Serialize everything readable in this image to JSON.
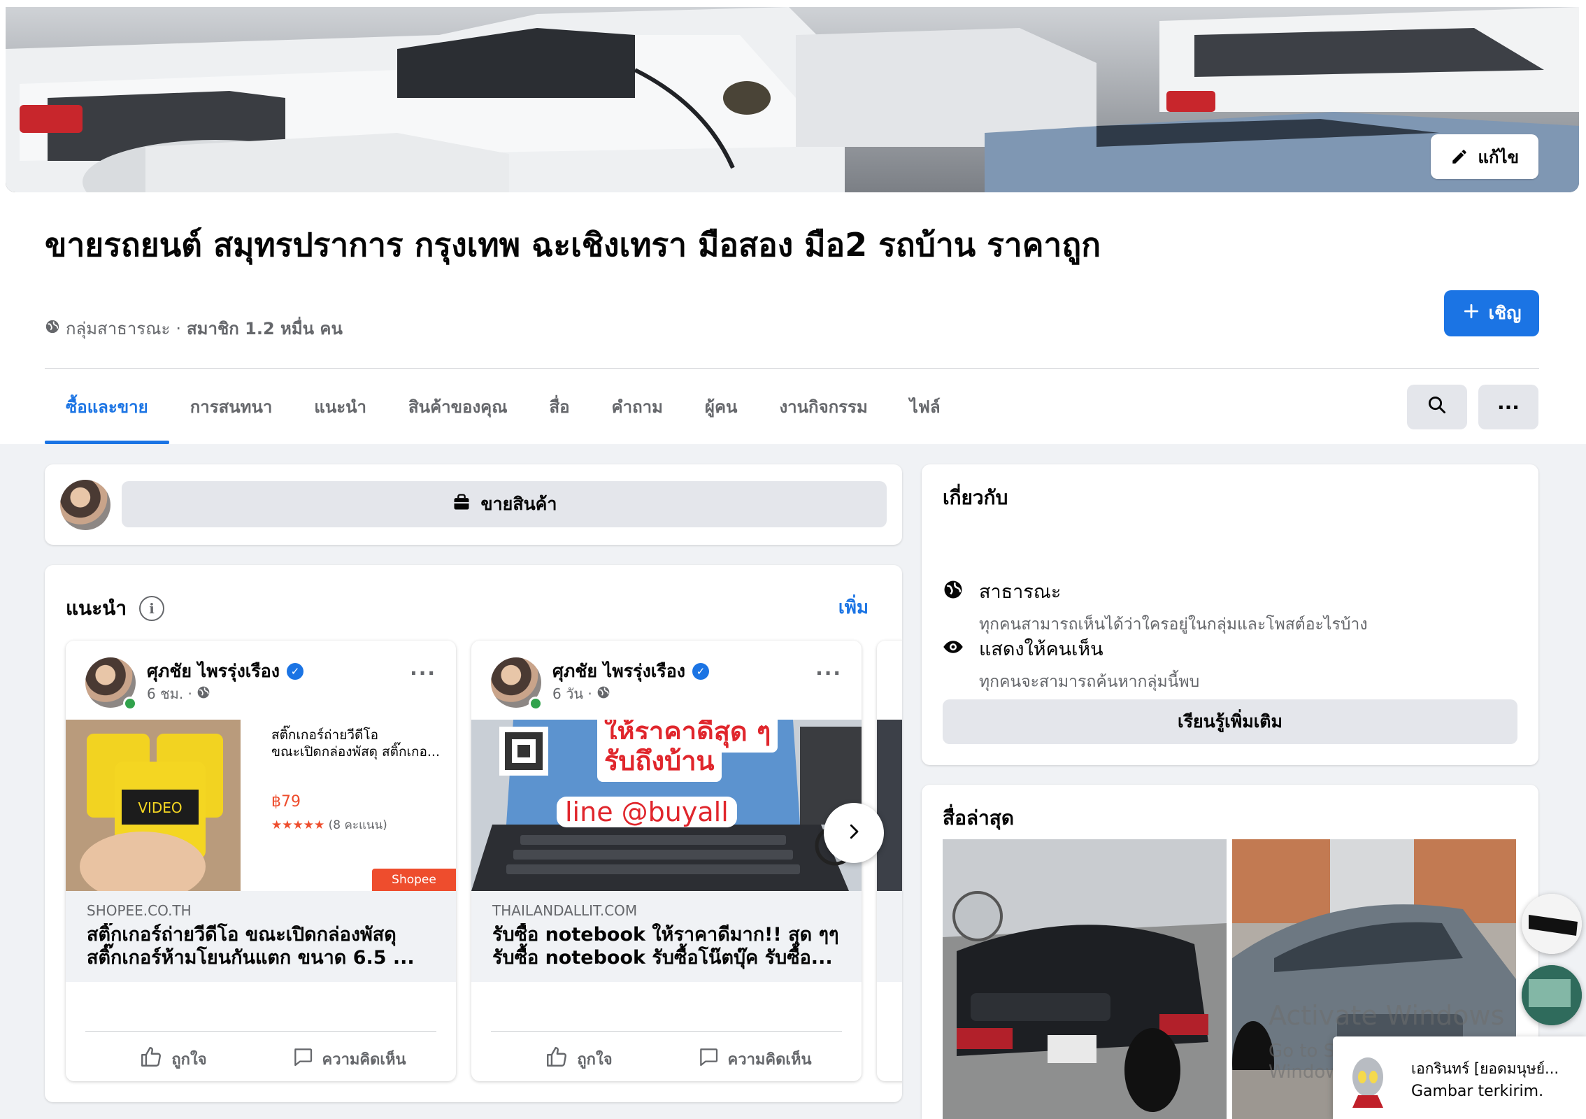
{
  "cover": {
    "edit_label": "แก้ไข"
  },
  "group": {
    "title": "ขายรถยนต์ สมุทรปราการ กรุงเทพ ฉะเชิงเทรา มือสอง มือ2 รถบ้าน ราคาถูก",
    "privacy": "กลุ่มสาธารณะ",
    "separator": "·",
    "members": "สมาชิก 1.2 หมื่น คน",
    "invite_label": "เชิญ"
  },
  "tabs": [
    {
      "label": "ซื้อและขาย",
      "active": true
    },
    {
      "label": "การสนทนา"
    },
    {
      "label": "แนะนำ"
    },
    {
      "label": "สินค้าของคุณ"
    },
    {
      "label": "สื่อ"
    },
    {
      "label": "คำถาม"
    },
    {
      "label": "ผู้คน"
    },
    {
      "label": "งานกิจกรรม"
    },
    {
      "label": "ไฟล์"
    }
  ],
  "tab_actions": {
    "more": "···"
  },
  "sell": {
    "label": "ขายสินค้า"
  },
  "recommended": {
    "title": "แนะนำ",
    "more_label": "เพิ่ม",
    "posts": [
      {
        "author": "ศุภชัย ไพรรุ่งเรือง",
        "time": "6 ชม. ·",
        "domain": "SHOPEE.CO.TH",
        "link_title": "สติ๊กเกอร์ถ่ายวีดีโอ ขณะเปิดกล่องพัสดุ สติ๊กเกอร์ห้ามโยนกันแตก ขนาด 6.5 ...",
        "promo_text_1": "สติ๊กเกอร์ถ่ายวีดีโอ",
        "promo_text_2": "ขณะเปิดกล่องพัสดุ สติ๊กเกอ...",
        "promo_price": "฿79",
        "promo_stars": "★★★★★",
        "promo_reviews": "(8 คะแนน)",
        "shopee_label": "Shopee",
        "like_label": "ถูกใจ",
        "comment_label": "ความคิดเห็น"
      },
      {
        "author": "ศุภชัย ไพรรุ่งเรือง",
        "time": "6 วัน ·",
        "domain": "THAILANDALLIT.COM",
        "link_title": "รับซื้อ notebook ให้ราคาดีมาก!! สุด ๆๆ รับซื้อ notebook รับซื้อโน๊ตบุ๊ค รับซื้อ...",
        "img_text_1": "ให้ราคาดีสุด ๆ",
        "img_text_2": "รับถึงบ้าน",
        "img_text_3": "line @buyall",
        "like_label": "ถูกใจ",
        "comment_label": "ความคิดเห็น"
      }
    ]
  },
  "about": {
    "title": "เกี่ยวกับ",
    "public_title": "สาธารณะ",
    "public_desc": "ทุกคนสามารถเห็นได้ว่าใครอยู่ในกลุ่มและโพสต์อะไรบ้าง",
    "visible_title": "แสดงให้คนเห็น",
    "visible_desc": "ทุกคนจะสามารถค้นหากลุ่มนี้พบ",
    "learn_more": "เรียนรู้เพิ่มเติม"
  },
  "media": {
    "title": "สื่อล่าสุด"
  },
  "windows": {
    "activate_title": "Activate Windows",
    "activate_desc": "Go to Settings to activate Windows."
  },
  "chat": {
    "name": "เอกรินทร์ [ยอดมนุษย์...",
    "message": "Gambar terkirim."
  },
  "colors": {
    "accent": "#1b74e4",
    "online": "#31a24c",
    "shopee": "#ee4d2d"
  }
}
